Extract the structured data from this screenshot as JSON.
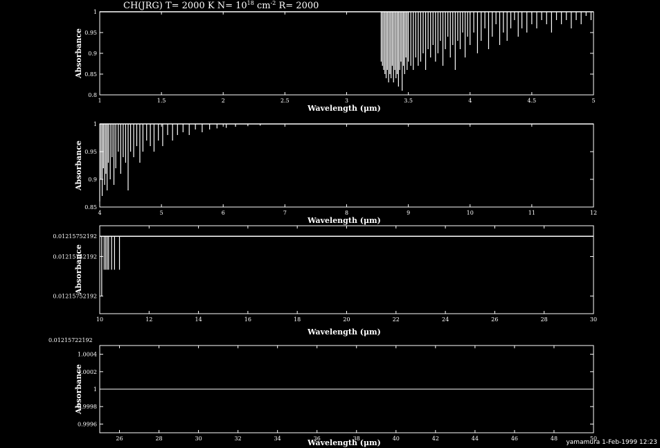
{
  "chart_data": [
    {
      "type": "line",
      "title": "CH(JRG) T= 2000 K N= 10^18 cm^-2 R= 2000",
      "title_parts": {
        "prefix": "CH(JRG) T= 2000 K N= 10",
        "exp1": "18",
        "mid": " cm",
        "exp2": "-2",
        "suffix": " R= 2000"
      },
      "xlabel": "Wavelength (μm)",
      "ylabel": "Absorbance",
      "xlim": [
        1,
        5
      ],
      "ylim": [
        0.8,
        1.0
      ],
      "xticks": [
        1,
        1.5,
        2,
        2.5,
        3,
        3.5,
        4,
        4.5,
        5
      ],
      "xtick_labels": [
        "1",
        "1.5",
        "2",
        "2.5",
        "3",
        "3.5",
        "4",
        "4.5",
        "5"
      ],
      "yticks": [
        0.8,
        0.85,
        0.9,
        0.95,
        1
      ],
      "ytick_labels": [
        "0.8",
        "0.85",
        "0.9",
        "0.95",
        "1"
      ],
      "baseline": 1.0,
      "lines": {
        "x": [
          3.28,
          3.29,
          3.3,
          3.31,
          3.32,
          3.33,
          3.34,
          3.35,
          3.36,
          3.37,
          3.38,
          3.39,
          3.4,
          3.41,
          3.42,
          3.43,
          3.44,
          3.45,
          3.46,
          3.47,
          3.48,
          3.49,
          3.5,
          3.52,
          3.54,
          3.56,
          3.58,
          3.6,
          3.62,
          3.64,
          3.66,
          3.68,
          3.7,
          3.72,
          3.74,
          3.76,
          3.78,
          3.8,
          3.82,
          3.84,
          3.86,
          3.88,
          3.9,
          3.92,
          3.94,
          3.96,
          3.98,
          4.0,
          4.03,
          4.06,
          4.09,
          4.12,
          4.15,
          4.18,
          4.21,
          4.24,
          4.27,
          4.3,
          4.33,
          4.36,
          4.39,
          4.42,
          4.46,
          4.5,
          4.54,
          4.58,
          4.62,
          4.66,
          4.7,
          4.74,
          4.78,
          4.82,
          4.86,
          4.9,
          4.94,
          4.98
        ],
        "y": [
          0.88,
          0.87,
          0.86,
          0.85,
          0.84,
          0.86,
          0.83,
          0.85,
          0.84,
          0.87,
          0.83,
          0.86,
          0.84,
          0.85,
          0.82,
          0.86,
          0.88,
          0.81,
          0.87,
          0.85,
          0.89,
          0.86,
          0.88,
          0.87,
          0.86,
          0.89,
          0.87,
          0.88,
          0.9,
          0.86,
          0.91,
          0.89,
          0.92,
          0.88,
          0.9,
          0.93,
          0.87,
          0.91,
          0.94,
          0.89,
          0.92,
          0.86,
          0.93,
          0.91,
          0.95,
          0.89,
          0.94,
          0.92,
          0.95,
          0.9,
          0.93,
          0.96,
          0.91,
          0.94,
          0.97,
          0.92,
          0.95,
          0.93,
          0.96,
          0.98,
          0.94,
          0.96,
          0.95,
          0.97,
          0.96,
          0.98,
          0.97,
          0.95,
          0.98,
          0.97,
          0.98,
          0.96,
          0.98,
          0.97,
          0.99,
          0.98
        ]
      }
    },
    {
      "type": "line",
      "xlabel": "Wavelength (μm)",
      "ylabel": "Absorbance",
      "xlim": [
        4,
        12
      ],
      "ylim": [
        0.85,
        1.0
      ],
      "xticks": [
        4,
        5,
        6,
        7,
        8,
        9,
        10,
        11,
        12
      ],
      "xtick_labels": [
        "4",
        "5",
        "6",
        "7",
        "8",
        "9",
        "10",
        "11",
        "12"
      ],
      "yticks": [
        0.85,
        0.9,
        0.95,
        1
      ],
      "ytick_labels": [
        "0.85",
        "0.9",
        "0.95",
        "1"
      ],
      "baseline": 1.0,
      "lines": {
        "x": [
          4.0,
          4.02,
          4.04,
          4.06,
          4.08,
          4.1,
          4.12,
          4.14,
          4.17,
          4.2,
          4.23,
          4.26,
          4.3,
          4.34,
          4.38,
          4.42,
          4.46,
          4.5,
          4.55,
          4.6,
          4.65,
          4.7,
          4.76,
          4.82,
          4.88,
          4.95,
          5.02,
          5.1,
          5.18,
          5.26,
          5.35,
          5.45,
          5.55,
          5.66,
          5.78,
          5.9,
          6.05,
          6.2,
          6.4,
          6.6
        ],
        "y": [
          0.86,
          0.9,
          0.87,
          0.92,
          0.89,
          0.91,
          0.88,
          0.93,
          0.9,
          0.94,
          0.89,
          0.92,
          0.95,
          0.91,
          0.94,
          0.93,
          0.88,
          0.95,
          0.94,
          0.96,
          0.93,
          0.95,
          0.97,
          0.96,
          0.95,
          0.97,
          0.96,
          0.98,
          0.97,
          0.98,
          0.985,
          0.98,
          0.99,
          0.985,
          0.99,
          0.992,
          0.993,
          0.995,
          0.996,
          0.997
        ]
      }
    },
    {
      "type": "line",
      "xlabel": "Wavelength (μm)",
      "ylabel": "Absorbance",
      "xlim": [
        10,
        30
      ],
      "ylim": [
        0,
        1
      ],
      "xticks": [
        10,
        12,
        14,
        16,
        18,
        20,
        22,
        24,
        26,
        28,
        30
      ],
      "xtick_labels": [
        "10",
        "12",
        "14",
        "16",
        "18",
        "20",
        "22",
        "24",
        "26",
        "28",
        "30"
      ],
      "ytick_labels": [
        "0.01215752192",
        "0.01215742192",
        "0.01215752192"
      ],
      "ytick_values": [
        0.88,
        0.65,
        0.2
      ],
      "baseline": 0.88,
      "lines": {
        "x": [
          10.08,
          10.18,
          10.24,
          10.3,
          10.36,
          10.48,
          10.6,
          10.8
        ],
        "y": [
          0.2,
          0.5,
          0.5,
          0.5,
          0.5,
          0.5,
          0.5,
          0.5
        ]
      }
    },
    {
      "type": "line",
      "xlabel": "Wavelength (μm)",
      "ylabel": "Absorbance",
      "xlim": [
        25,
        50
      ],
      "ylim": [
        0.9995,
        1.0005
      ],
      "xticks": [
        26,
        28,
        30,
        32,
        34,
        36,
        38,
        40,
        42,
        44,
        46,
        48,
        50
      ],
      "xtick_labels": [
        "26",
        "28",
        "30",
        "32",
        "34",
        "36",
        "38",
        "40",
        "42",
        "44",
        "46",
        "48",
        "50"
      ],
      "yticks": [
        0.9996,
        0.9998,
        1,
        1.0002,
        1.0004
      ],
      "ytick_labels": [
        "0.9996",
        "0.9998",
        "1",
        "1.0002",
        "1.0004"
      ],
      "corner_label": "0.01215722192",
      "flat_line_y": 1.0
    }
  ],
  "footer": {
    "credit": "yamamura  1-Feb-1999 12:23"
  },
  "colors": {
    "background": "#000000",
    "foreground": "#ffffff"
  }
}
